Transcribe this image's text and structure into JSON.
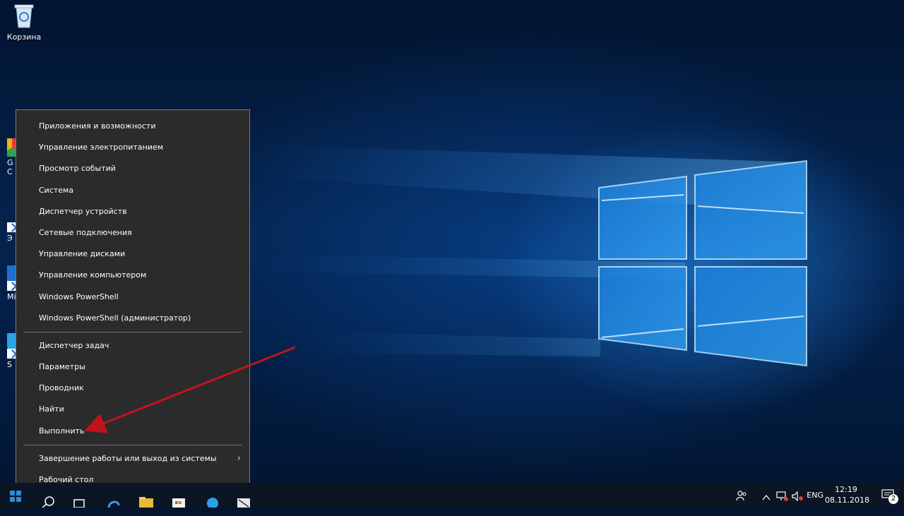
{
  "desktop": {
    "recycle_bin_label": "Корзина",
    "partial_icons": [
      {
        "text": "G"
      },
      {
        "text": "C"
      },
      {
        "text": "Э"
      },
      {
        "text": "Mi"
      },
      {
        "text": "S"
      }
    ]
  },
  "menu": {
    "group1": [
      "Приложения и возможности",
      "Управление электропитанием",
      "Просмотр событий",
      "Система",
      "Диспетчер устройств",
      "Сетевые подключения",
      "Управление дисками",
      "Управление компьютером",
      "Windows PowerShell",
      "Windows PowerShell (администратор)"
    ],
    "group2": [
      "Диспетчер задач",
      "Параметры",
      "Проводник",
      "Найти",
      "Выполнить"
    ],
    "group3": [
      "Завершение работы или выход из системы",
      "Рабочий стол"
    ]
  },
  "taskbar": {
    "language": "ENG",
    "time": "12:19",
    "date": "08.11.2018",
    "notifications_count": "2"
  },
  "colors": {
    "menu_bg": "#2b2b2b",
    "arrow": "#c0141a",
    "accent": "#2f8bd6"
  }
}
